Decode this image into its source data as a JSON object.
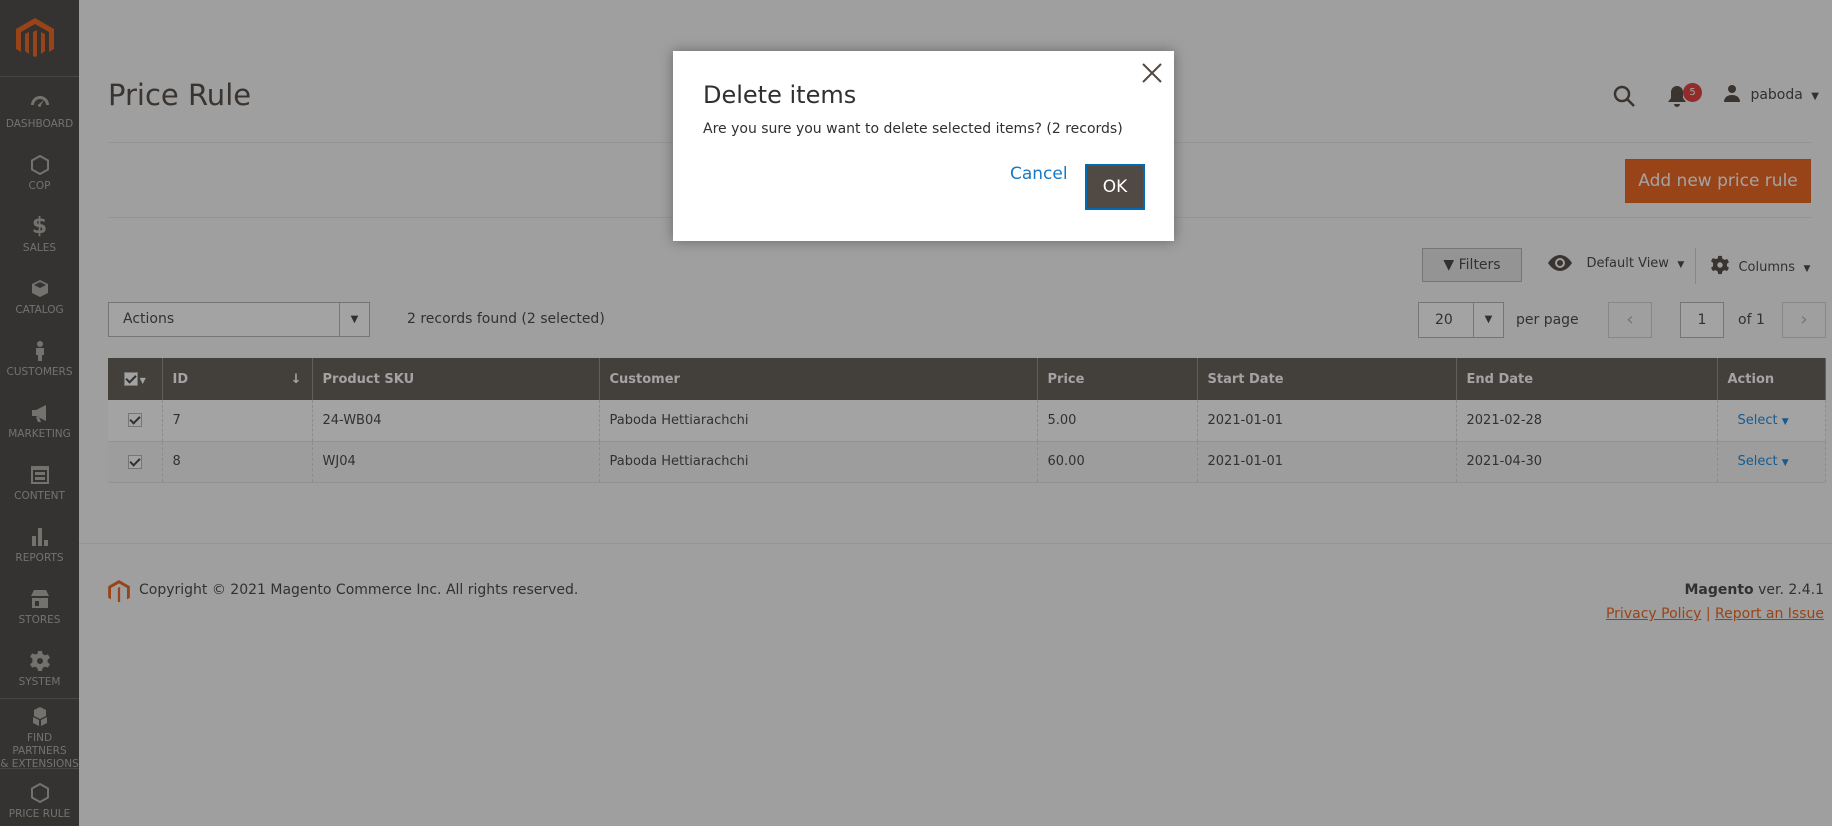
{
  "sidebar": {
    "items": [
      {
        "label": "DASHBOARD",
        "icon": "dashboard-icon"
      },
      {
        "label": "COP",
        "icon": "hexagon-icon"
      },
      {
        "label": "SALES",
        "icon": "dollar-icon"
      },
      {
        "label": "CATALOG",
        "icon": "box-icon"
      },
      {
        "label": "CUSTOMERS",
        "icon": "person-icon"
      },
      {
        "label": "MARKETING",
        "icon": "megaphone-icon"
      },
      {
        "label": "CONTENT",
        "icon": "layout-icon"
      },
      {
        "label": "REPORTS",
        "icon": "bar-chart-icon"
      },
      {
        "label": "STORES",
        "icon": "store-icon"
      },
      {
        "label": "SYSTEM",
        "icon": "gear-icon"
      },
      {
        "label_line1": "FIND PARTNERS",
        "label_line2": "& EXTENSIONS",
        "icon": "cubes-icon"
      },
      {
        "label": "PRICE RULE",
        "icon": "hexagon-icon"
      }
    ]
  },
  "header": {
    "title": "Price Rule",
    "notifications_count": "5",
    "username": "paboda"
  },
  "toolbar": {
    "add_label": "Add new price rule",
    "filters_label": "Filters",
    "view_label": "Default View",
    "columns_label": "Columns",
    "actions_label": "Actions",
    "records_text": "2 records found (2 selected)",
    "per_page_value": "20",
    "per_page_label": "per page",
    "page_value": "1",
    "page_of": "of 1"
  },
  "table": {
    "columns": [
      "ID",
      "Product SKU",
      "Customer",
      "Price",
      "Start Date",
      "End Date",
      "Action"
    ],
    "rows": [
      {
        "id": "7",
        "sku": "24-WB04",
        "customer": "Paboda Hettiarachchi",
        "price": "5.00",
        "start": "2021-01-01",
        "end": "2021-02-28",
        "action": "Select"
      },
      {
        "id": "8",
        "sku": "WJ04",
        "customer": "Paboda Hettiarachchi",
        "price": "60.00",
        "start": "2021-01-01",
        "end": "2021-04-30",
        "action": "Select"
      }
    ]
  },
  "footer": {
    "copyright": "Copyright © 2021 Magento Commerce Inc. All rights reserved.",
    "brand": "Magento",
    "version": " ver. 2.4.1",
    "privacy": "Privacy Policy",
    "separator": "|",
    "report": "Report an Issue"
  },
  "modal": {
    "title": "Delete items",
    "message": "Are you sure you want to delete selected items? (2 records)",
    "cancel_label": "Cancel",
    "ok_label": "OK"
  },
  "colors": {
    "accent": "#eb5202",
    "sidebar_bg": "#373330",
    "table_header": "#514943"
  }
}
